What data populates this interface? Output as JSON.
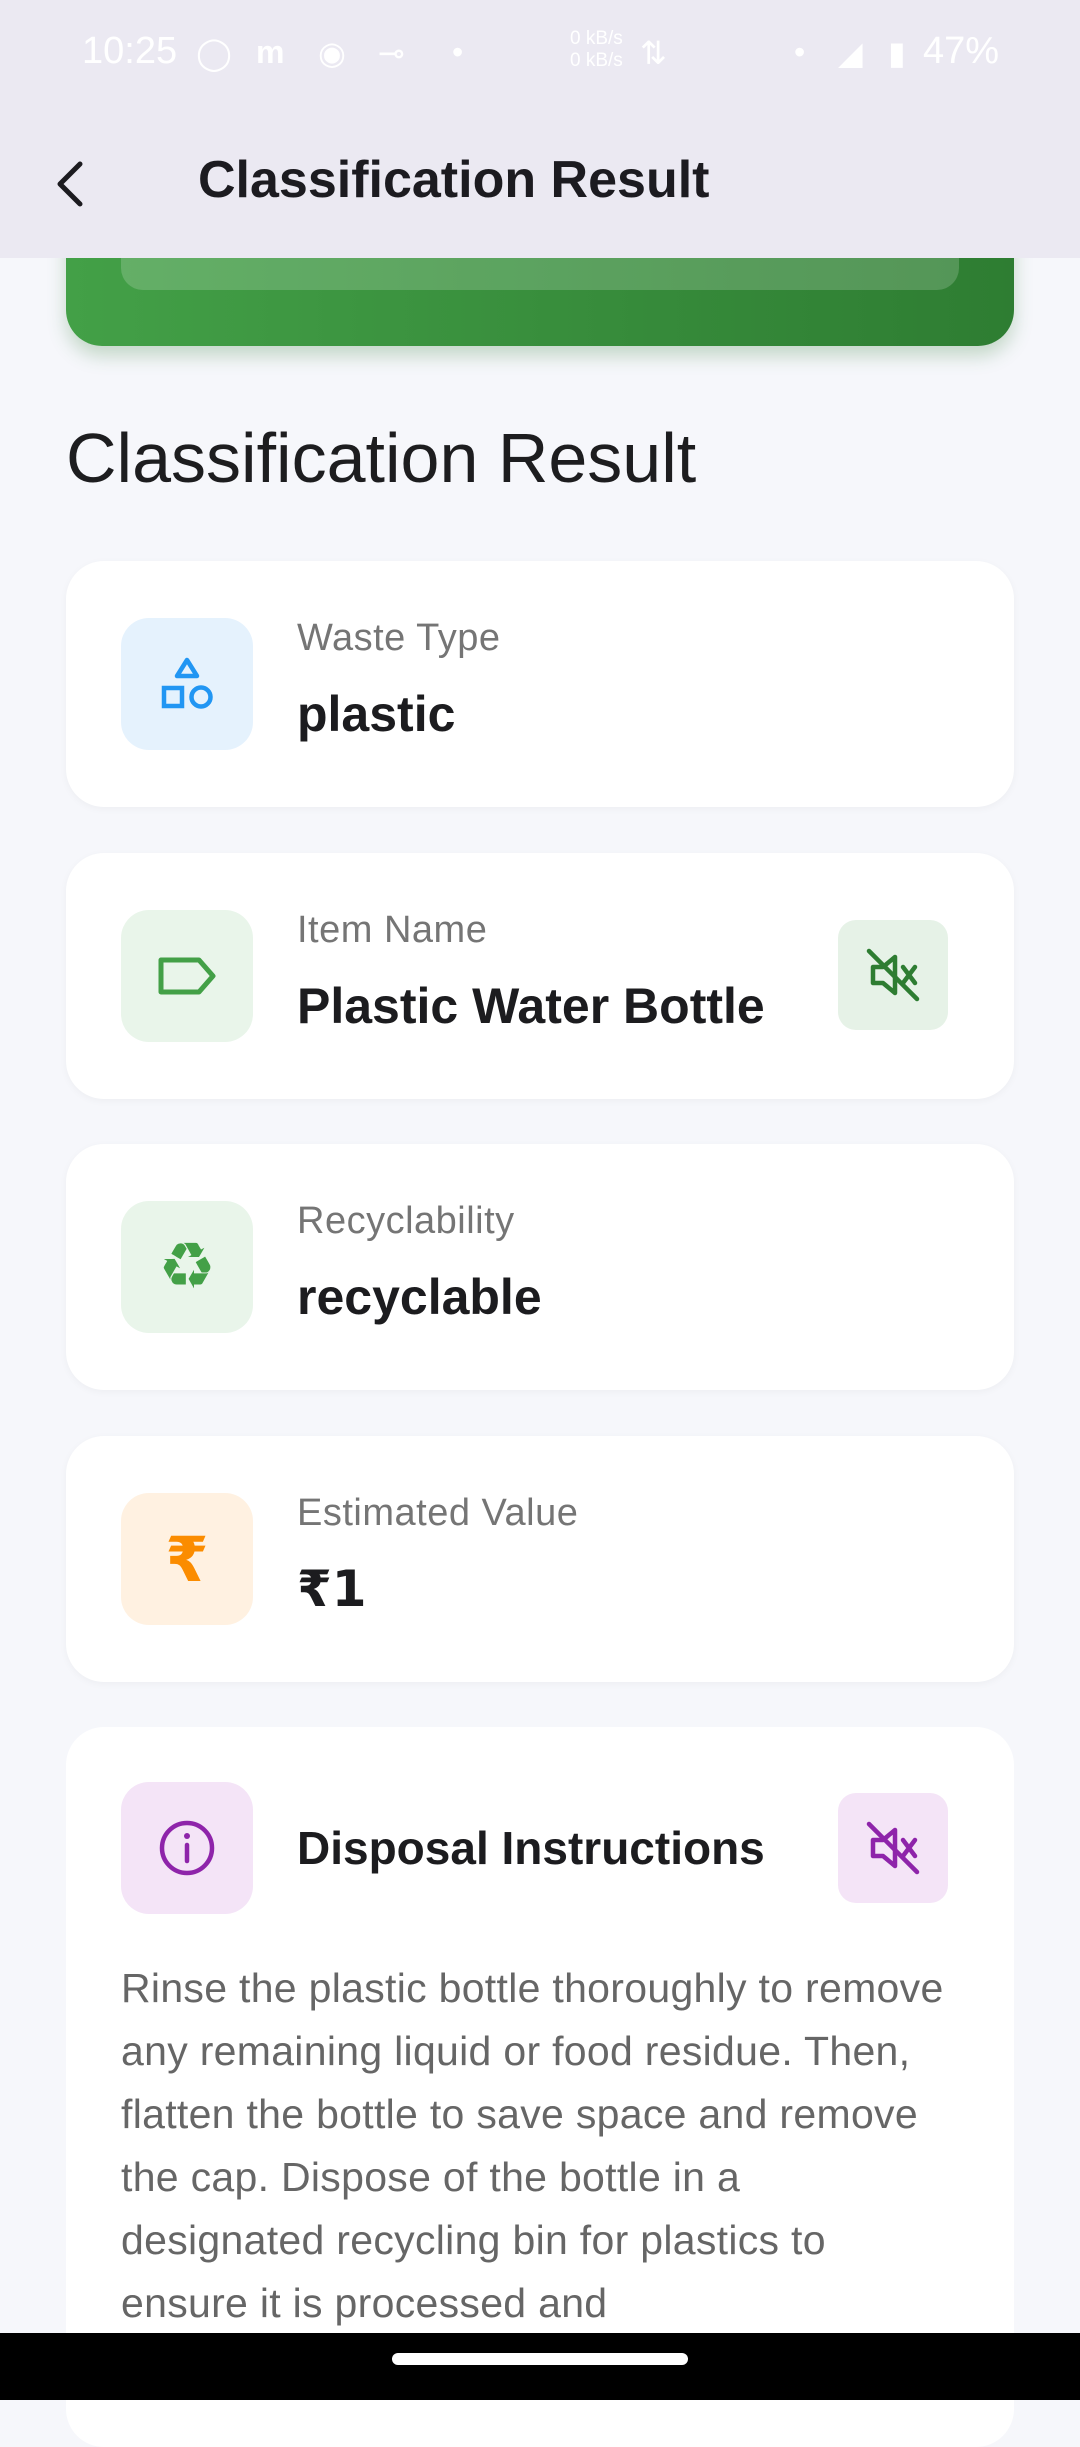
{
  "status_bar": {
    "time": "10:25",
    "net_up": "0 kB/s",
    "net_down": "0 kB/s",
    "battery": "47%"
  },
  "app_bar": {
    "title": "Classification Result"
  },
  "section_title": "Classification Result",
  "cards": {
    "waste_type": {
      "label": "Waste Type",
      "value": "plastic"
    },
    "item_name": {
      "label": "Item Name",
      "value": "Plastic Water Bottle"
    },
    "recyclability": {
      "label": "Recyclability",
      "value": "recyclable"
    },
    "estimated_value": {
      "label": "Estimated Value",
      "value": "₹1"
    }
  },
  "disposal": {
    "heading": "Disposal Instructions",
    "text": "Rinse the plastic bottle thoroughly to remove any remaining liquid or food residue. Then, flatten the bottle to save space and remove the cap. Dispose of the bottle in a designated recycling bin for plastics to ensure it is processed and"
  },
  "colors": {
    "blue": "#2196f3",
    "green": "#43a047",
    "dark_green": "#2e7d32",
    "orange": "#fb8c00",
    "purple": "#8e24aa"
  }
}
